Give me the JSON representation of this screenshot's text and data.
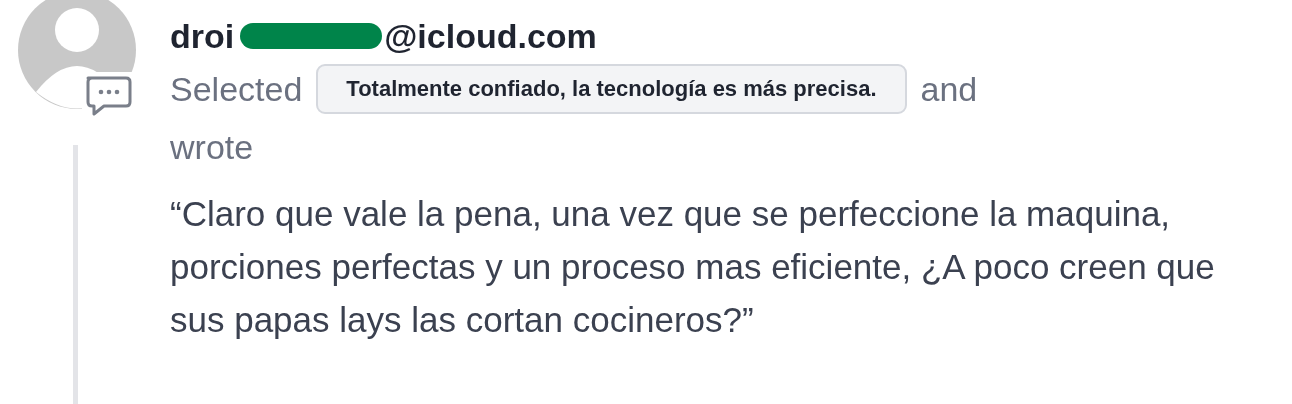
{
  "author": {
    "email_start": "droi",
    "redacted": true,
    "email_end": "@icloud.com"
  },
  "action": {
    "before": "Selected",
    "choice": "Totalmente confiado, la tecnología es más precisa.",
    "after": "and",
    "verb": "wrote"
  },
  "comment": "“Claro que vale la pena, una vez que se perfeccione la maquina, porciones perfectas y un proceso mas eficiente, ¿A poco creen que sus papas lays las cortan cocineros?”"
}
